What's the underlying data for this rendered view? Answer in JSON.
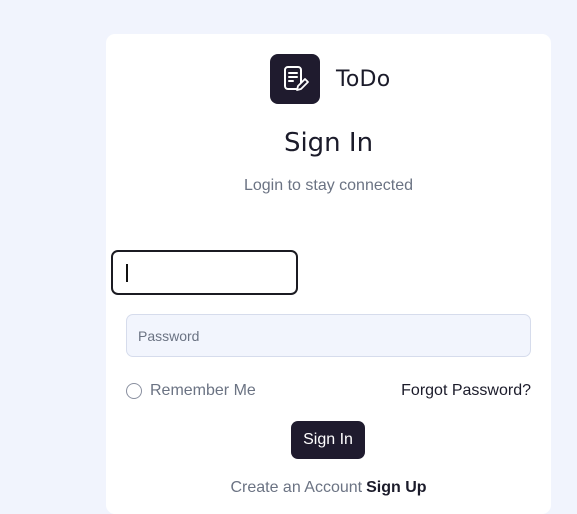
{
  "app": {
    "name": "ToDo",
    "logo_icon": "notepad-edit-icon"
  },
  "form": {
    "title": "Sign In",
    "subtitle": "Login to stay connected",
    "username": {
      "value": "",
      "placeholder": ""
    },
    "password": {
      "value": "",
      "placeholder": "Password"
    },
    "remember_label": "Remember Me",
    "remember_checked": false,
    "forgot_label": "Forgot Password?",
    "submit_label": "Sign In",
    "create_text": "Create an Account",
    "signup_label": "Sign Up"
  },
  "colors": {
    "page_background": "#f1f4fd",
    "brand_dark": "#1f1b2e",
    "muted_text": "#6b7383",
    "input_background": "#f2f5fd"
  }
}
